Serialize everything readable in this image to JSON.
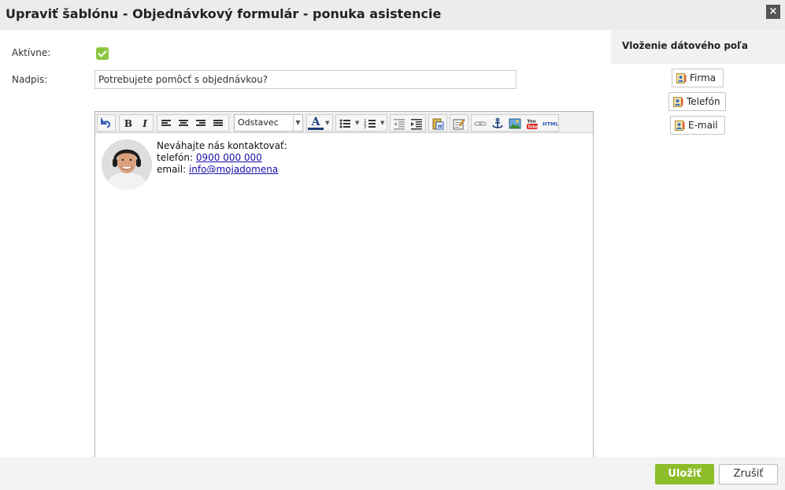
{
  "dialog": {
    "title": "Upraviť šablónu - Objednávkový formulár - ponuka asistencie",
    "close_glyph": "×"
  },
  "form": {
    "active_label": "Aktívne:",
    "active_checked": true,
    "heading_label": "Nadpis:",
    "heading_value": "Potrebujete pomôcť s objednávkou?"
  },
  "editor": {
    "toolbar": {
      "undo_icon": "undo-icon",
      "bold_label": "B",
      "italic_label": "I",
      "format_select_value": "Odstavec",
      "font_color_label": "A"
    },
    "content": {
      "line1": "Neváhajte nás kontaktovať:",
      "phone_label": "telefón: ",
      "phone_value": "0900 000 000",
      "email_label": "email: ",
      "email_value": "info@mojadomena"
    }
  },
  "side_panel": {
    "title": "Vloženie dátového poľa",
    "fields": [
      "Firma",
      "Telefón",
      "E-mail"
    ]
  },
  "footer": {
    "save_label": "Uložiť",
    "cancel_label": "Zrušiť"
  },
  "colors": {
    "accent_green": "#8cbd2a",
    "checkbox_green": "#8cc63f",
    "link_blue": "#1a0dab"
  }
}
